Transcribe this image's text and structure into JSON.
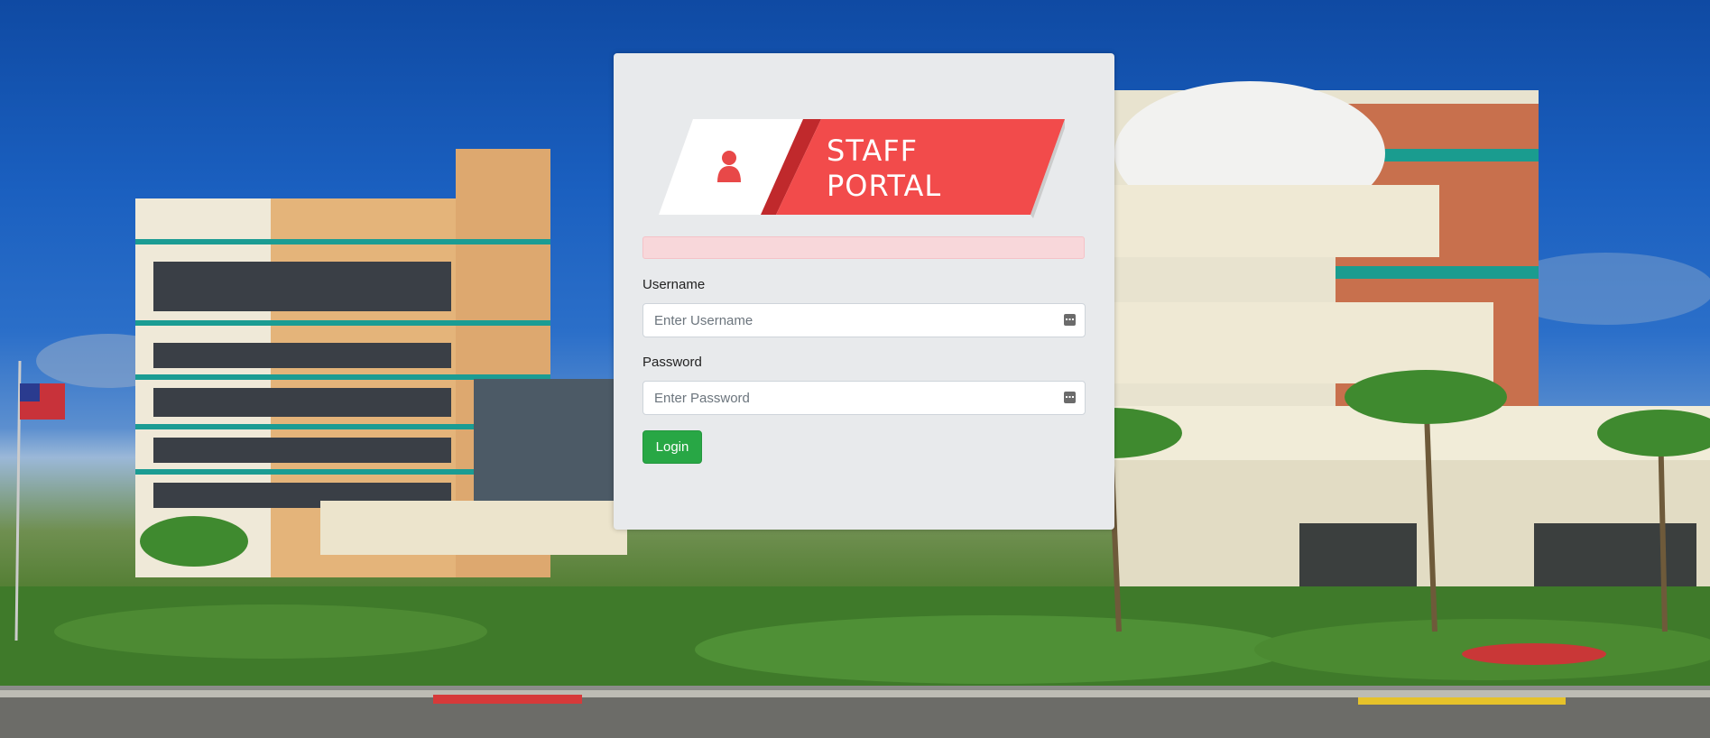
{
  "logo": {
    "line1": "STAFF",
    "line2": "PORTAL",
    "icon": "user-icon",
    "accent_color": "#f24b4b"
  },
  "form": {
    "username_label": "Username",
    "username_placeholder": "Enter Username",
    "username_value": "",
    "password_label": "Password",
    "password_placeholder": "Enter Password",
    "password_value": "",
    "login_label": "Login",
    "field_icon": "password-manager-key-icon"
  },
  "colors": {
    "button": "#28a745",
    "alert_bg": "#f8d7da",
    "card_bg": "#e8eaec"
  }
}
